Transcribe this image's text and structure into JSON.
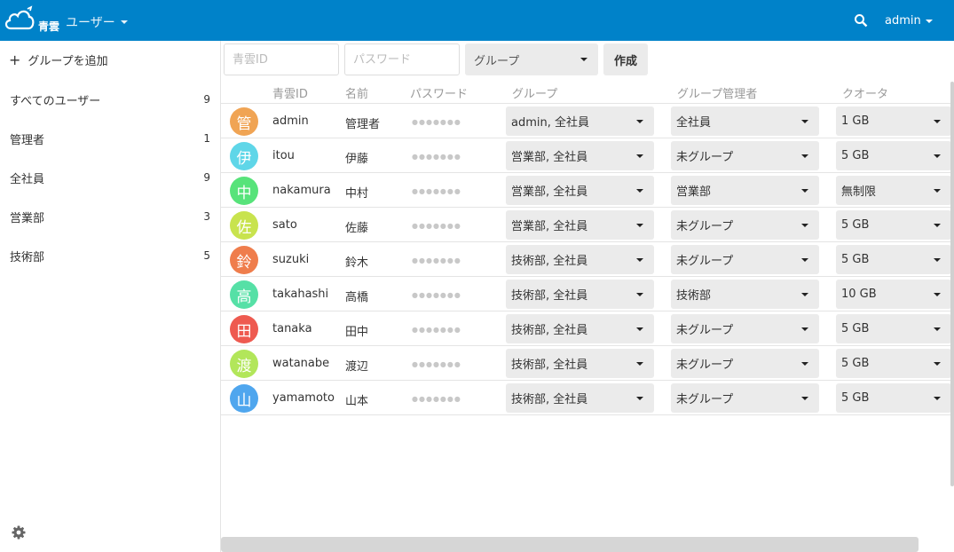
{
  "header": {
    "logo_text": "青雲",
    "app_name": "ユーザー",
    "user_name": "admin"
  },
  "sidebar": {
    "add_group_label": "グループを追加",
    "groups": [
      {
        "label": "すべてのユーザー",
        "count": "9"
      },
      {
        "label": "管理者",
        "count": "1"
      },
      {
        "label": "全社員",
        "count": "9"
      },
      {
        "label": "営業部",
        "count": "3"
      },
      {
        "label": "技術部",
        "count": "5"
      }
    ]
  },
  "toolbar": {
    "id_placeholder": "青雲ID",
    "password_placeholder": "パスワード",
    "group_select_label": "グループ",
    "create_label": "作成"
  },
  "table": {
    "headers": {
      "id": "青雲ID",
      "name": "名前",
      "password": "パスワード",
      "groups": "グループ",
      "subadmin": "グループ管理者",
      "quota": "クオータ"
    },
    "password_mask": "●●●●●●●",
    "rows": [
      {
        "avatar": "管",
        "color": "#f0a454",
        "id": "admin",
        "name": "管理者",
        "groups": "admin, 全社員",
        "subadmin": "全社員",
        "quota": "1 GB"
      },
      {
        "avatar": "伊",
        "color": "#5fd6e8",
        "id": "itou",
        "name": "伊藤",
        "groups": "営業部, 全社員",
        "subadmin": "未グループ",
        "quota": "5 GB"
      },
      {
        "avatar": "中",
        "color": "#57e37a",
        "id": "nakamura",
        "name": "中村",
        "groups": "営業部, 全社員",
        "subadmin": "営業部",
        "quota": "無制限"
      },
      {
        "avatar": "佐",
        "color": "#c8e34e",
        "id": "sato",
        "name": "佐藤",
        "groups": "営業部, 全社員",
        "subadmin": "未グループ",
        "quota": "5 GB"
      },
      {
        "avatar": "鈴",
        "color": "#ef7d4c",
        "id": "suzuki",
        "name": "鈴木",
        "groups": "技術部, 全社員",
        "subadmin": "未グループ",
        "quota": "5 GB"
      },
      {
        "avatar": "高",
        "color": "#56e0a6",
        "id": "takahashi",
        "name": "高橋",
        "groups": "技術部, 全社員",
        "subadmin": "技術部",
        "quota": "10 GB"
      },
      {
        "avatar": "田",
        "color": "#ee5a50",
        "id": "tanaka",
        "name": "田中",
        "groups": "技術部, 全社員",
        "subadmin": "未グループ",
        "quota": "5 GB"
      },
      {
        "avatar": "渡",
        "color": "#b2e65a",
        "id": "watanabe",
        "name": "渡辺",
        "groups": "技術部, 全社員",
        "subadmin": "未グループ",
        "quota": "5 GB"
      },
      {
        "avatar": "山",
        "color": "#4fa6ee",
        "id": "yamamoto",
        "name": "山本",
        "groups": "技術部, 全社員",
        "subadmin": "未グループ",
        "quota": "5 GB"
      }
    ]
  }
}
